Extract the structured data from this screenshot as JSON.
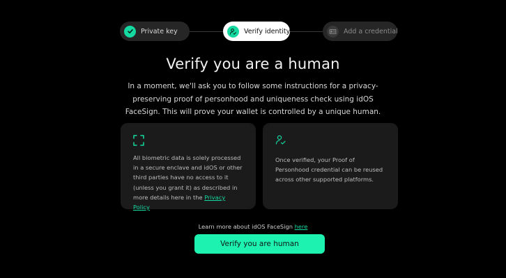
{
  "stepper": {
    "steps": [
      {
        "label": "Private key",
        "state": "done",
        "icon": "check-icon"
      },
      {
        "label": "Verify identity",
        "state": "active",
        "icon": "person-check-icon"
      },
      {
        "label": "Add a credential",
        "state": "todo",
        "icon": "id-card-icon"
      }
    ]
  },
  "main": {
    "title": "Verify you are a human",
    "intro": "In a moment, we'll ask you to follow some instructions for a privacy-preserving proof of personhood and uniqueness check using idOS FaceSign. This will prove your wallet is controlled by a unique human."
  },
  "cards": [
    {
      "icon": "face-scan-icon",
      "text": "All biometric data is solely processed in a secure enclave and idOS or other third parties have no access to it (unless you grant it) as described in more details here in the ",
      "link": "Privacy Policy"
    },
    {
      "icon": "person-check-icon",
      "text": "Once verified, your Proof of Personhood credential can be reused across other supported platforms."
    }
  ],
  "learn_more": {
    "text": "Learn more about idOS FaceSign ",
    "link": "here"
  },
  "cta": {
    "label": "Verify you are human"
  },
  "colors": {
    "background": "#000000",
    "accent": "#14d9a0",
    "cta": "#1ef2b0",
    "card": "#1b1b1b"
  }
}
